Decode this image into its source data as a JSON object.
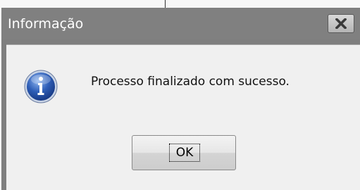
{
  "dialog": {
    "title": "Informação",
    "message": "Processo finalizado com sucesso.",
    "ok_label": "OK",
    "close_icon": "close-icon",
    "info_icon": "information-icon"
  },
  "colors": {
    "titlebar": "#808080",
    "title_text": "#ffffff",
    "client_bg": "#f0f0f0",
    "icon_blue": "#2f5fb8"
  }
}
